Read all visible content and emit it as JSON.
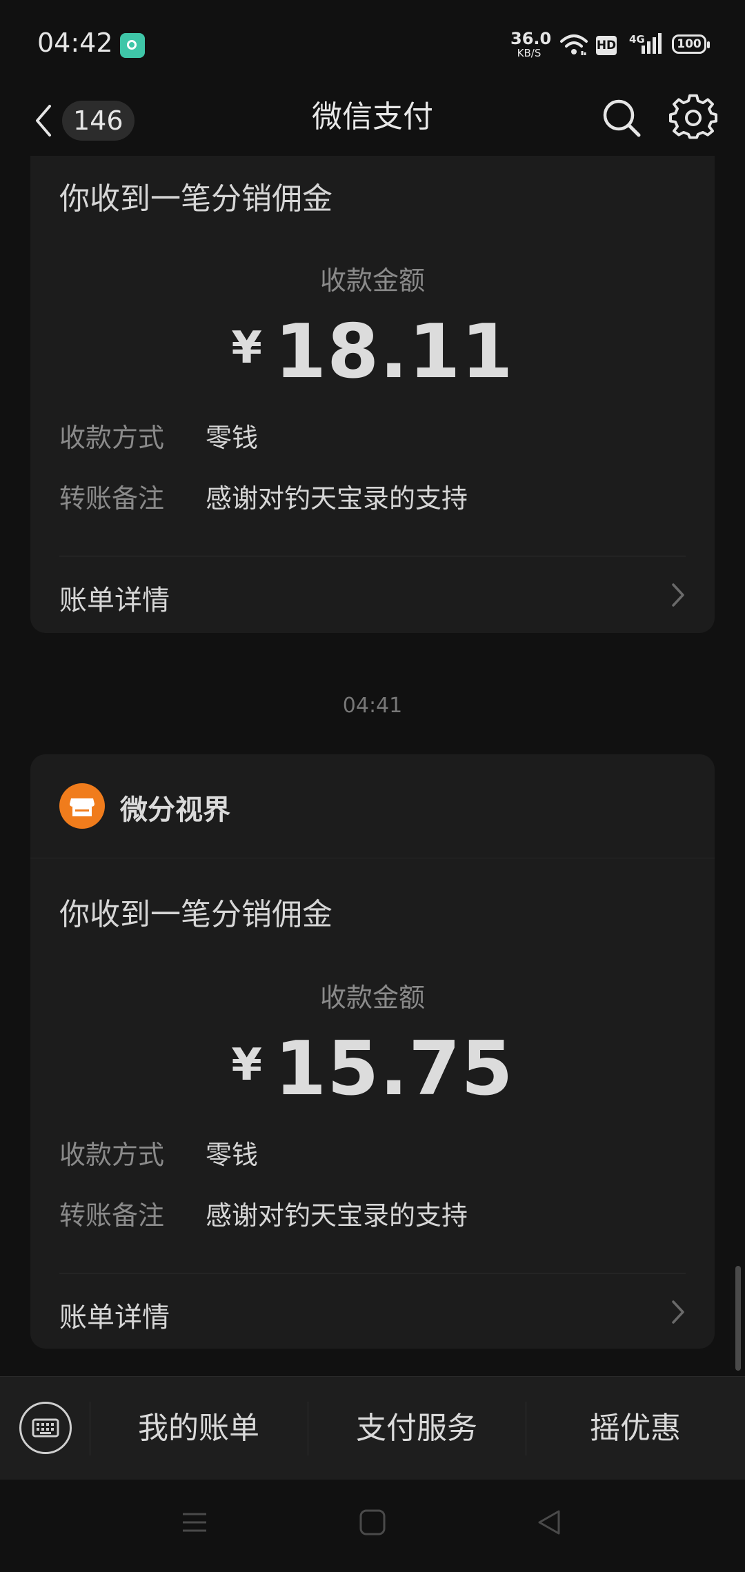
{
  "status_bar": {
    "time": "04:42",
    "net_speed_value": "36.0",
    "net_speed_unit": "KB/S",
    "hd": "HD",
    "network": "4G",
    "battery": "100"
  },
  "nav": {
    "unread_count": "146",
    "title": "微信支付",
    "icons": [
      "chevron-left-icon",
      "search-icon",
      "gear-icon"
    ]
  },
  "cards": [
    {
      "title": "你收到一笔分销佣金",
      "amount_label": "收款金额",
      "currency": "¥",
      "amount": "18.11",
      "method_label": "收款方式",
      "method_value": "零钱",
      "note_label": "转账备注",
      "note_value": "感谢对钓天宝录的支持",
      "detail_label": "账单详情"
    },
    {
      "merchant_name": "微分视界",
      "title": "你收到一笔分销佣金",
      "amount_label": "收款金额",
      "currency": "¥",
      "amount": "15.75",
      "method_label": "收款方式",
      "method_value": "零钱",
      "note_label": "转账备注",
      "note_value": "感谢对钓天宝录的支持",
      "detail_label": "账单详情"
    }
  ],
  "timestamp": "04:41",
  "bottom_menu": {
    "items": [
      "我的账单",
      "支付服务",
      "摇优惠"
    ]
  },
  "colors": {
    "background": "#111111",
    "card": "#1c1c1c",
    "merchant_avatar": "#f07c1c"
  }
}
